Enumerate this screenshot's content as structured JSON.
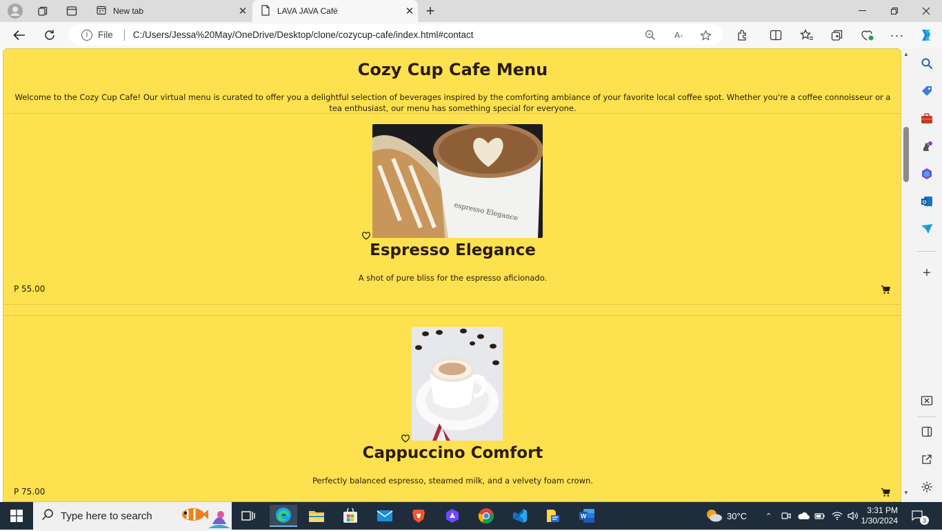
{
  "browser": {
    "tabs": [
      {
        "title": "New tab",
        "active": false
      },
      {
        "title": "LAVA JAVA Café",
        "active": true
      }
    ],
    "address": {
      "scheme_label": "File",
      "url": "C:/Users/Jessa%20May/OneDrive/Desktop/clone/cozycup-cafe/index.html#contact"
    }
  },
  "page": {
    "title": "Cozy Cup Cafe Menu",
    "intro": "Welcome to the Cozy Cup Cafe! Our virtual menu is curated to offer you a delightful selection of beverages inspired by the comforting ambiance of your favorite local coffee spot. Whether you're a coffee connoisseur or a tea enthusiast, our menu has something special for everyone.",
    "background_color": "#fde14f",
    "items": [
      {
        "name": "Espresso Elegance",
        "description": "A shot of pure bliss for the espresso aficionado.",
        "price": "P 55.00",
        "image": "latte-cup-with-pastry"
      },
      {
        "name": "Cappuccino Comfort",
        "description": "Perfectly balanced espresso, steamed milk, and a velvety foam crown.",
        "price": "P 75.00",
        "image": "cappuccino-cup-with-beans"
      }
    ]
  },
  "taskbar": {
    "search_placeholder": "Type here to search",
    "weather": "30°C",
    "time": "3:31 PM",
    "date": "1/30/2024",
    "notification_count": "3"
  }
}
